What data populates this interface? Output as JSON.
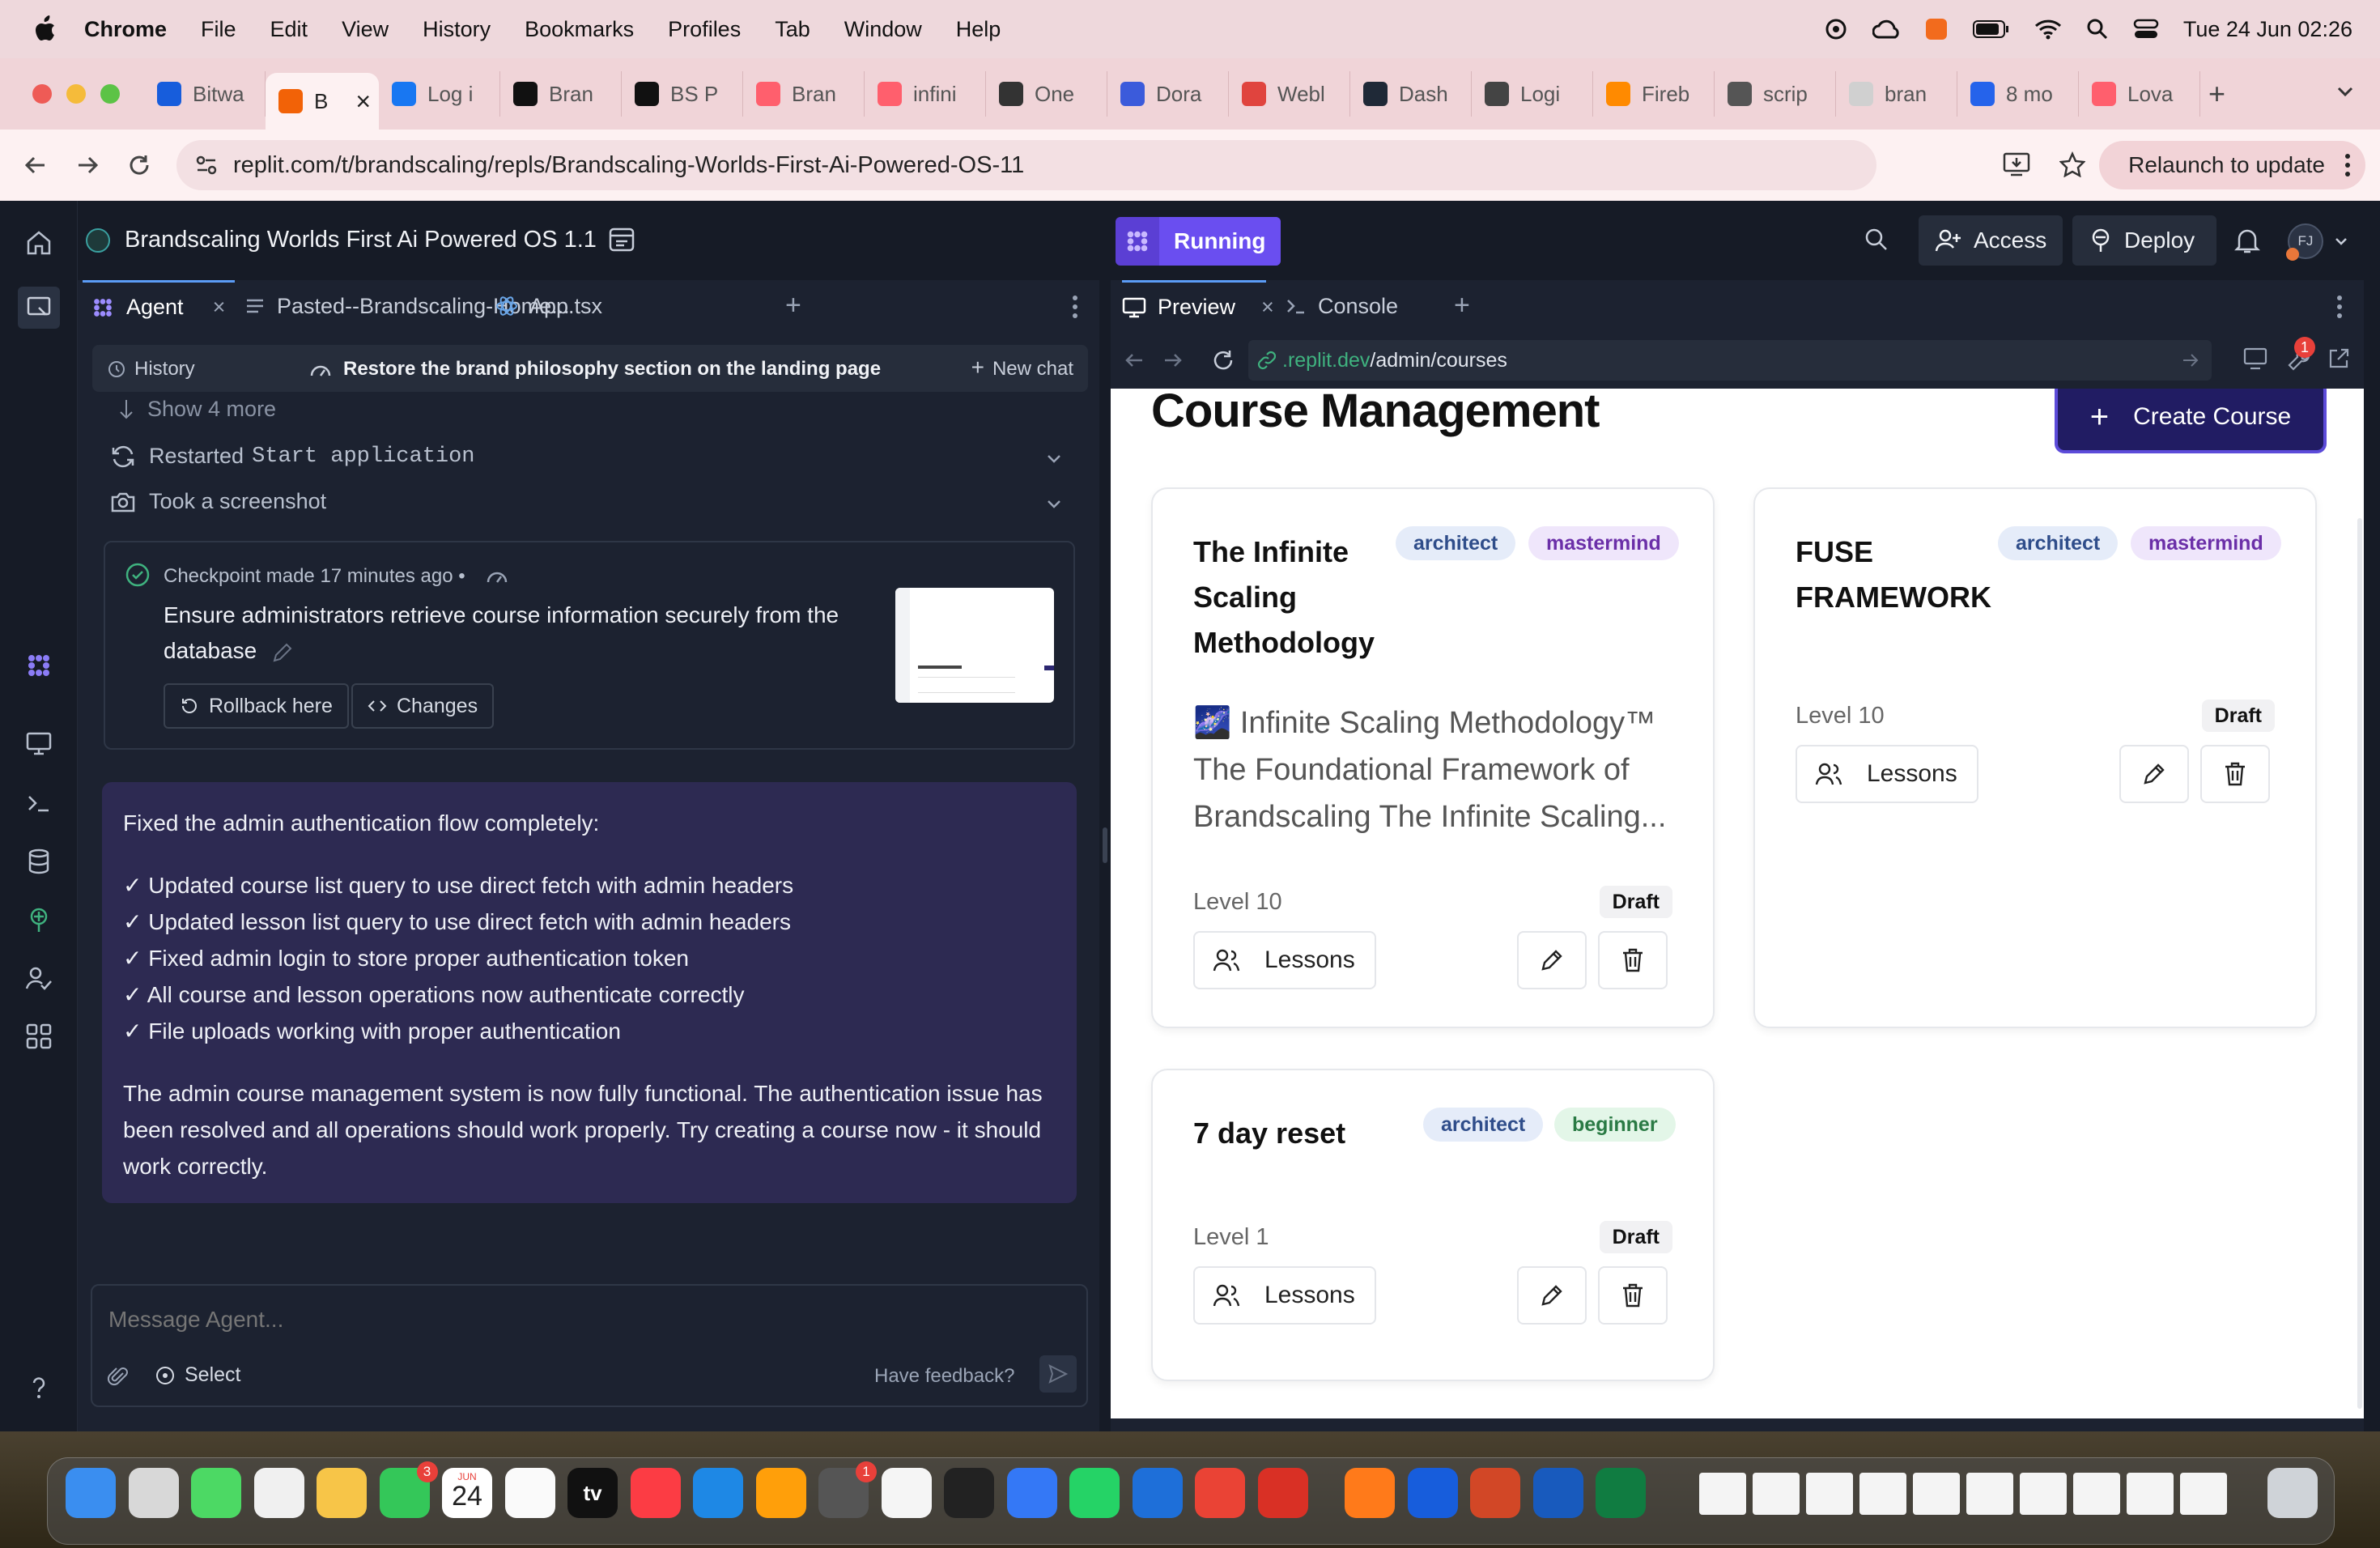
{
  "menubar": {
    "app": "Chrome",
    "items": [
      "File",
      "Edit",
      "View",
      "History",
      "Bookmarks",
      "Profiles",
      "Tab",
      "Window",
      "Help"
    ],
    "datetime": "Tue 24 Jun  02:26"
  },
  "tabs": [
    {
      "label": "Bitwa",
      "color": "#175ddc"
    },
    {
      "label": "B",
      "color": "#f26207",
      "active": true
    },
    {
      "label": "Log i",
      "color": "#1877f2"
    },
    {
      "label": "Bran",
      "color": "#111111"
    },
    {
      "label": "BS P",
      "color": "#111111"
    },
    {
      "label": "Bran",
      "color": "#ff5f6d"
    },
    {
      "label": "infini",
      "color": "#ff5f6d"
    },
    {
      "label": "One",
      "color": "#333333"
    },
    {
      "label": "Dora",
      "color": "#3b5bdb"
    },
    {
      "label": "Webl",
      "color": "#e0443e"
    },
    {
      "label": "Dash",
      "color": "#1f2937"
    },
    {
      "label": "Logi",
      "color": "#444444"
    },
    {
      "label": "Fireb",
      "color": "#ff8a00"
    },
    {
      "label": "scrip",
      "color": "#555555"
    },
    {
      "label": "bran",
      "color": "#d0d0d0"
    },
    {
      "label": "8 mo",
      "color": "#2563eb"
    },
    {
      "label": "Lova",
      "color": "#ff5f6d"
    }
  ],
  "tab_close": "×",
  "new_tab": "+",
  "address": {
    "url": "replit.com/t/brandscaling/repls/Brandscaling-Worlds-First-Ai-Powered-OS-11",
    "relaunch": "Relaunch to update"
  },
  "replit": {
    "project_title": "Brandscaling Worlds First Ai Powered OS 1.1",
    "status": "Running",
    "access": "Access",
    "deploy": "Deploy",
    "avatar_initials": "FJ",
    "left_tabs": [
      "Agent",
      "Pasted--Brandscaling-Home...",
      "App.tsx"
    ],
    "right_tabs": [
      "Preview",
      "Console"
    ],
    "history_label": "History",
    "chat_title": "Restore the brand philosophy section on the landing page",
    "new_chat": "New chat",
    "show_more": "Show 4 more",
    "restarted_prefix": "Restarted",
    "restarted_cmd": "Start application",
    "screenshot": "Took a screenshot",
    "checkpoint_meta": "Checkpoint made 17 minutes ago  •",
    "checkpoint_desc": "Ensure administrators retrieve course information securely from the database",
    "rollback": "Rollback here",
    "changes": "Changes",
    "message": {
      "intro": "Fixed the admin authentication flow completely:",
      "items": [
        "✓ Updated course list query to use direct fetch with admin headers",
        "✓ Updated lesson list query to use direct fetch with admin headers",
        "✓ Fixed admin login to store proper authentication token",
        "✓ All course and lesson operations now authenticate correctly",
        "✓ File uploads working with proper authentication"
      ],
      "outro": "The admin course management system is now fully functional. The authentication issue has been resolved and all operations should work properly. Try creating a course now - it should work correctly."
    },
    "composer": {
      "placeholder": "Message Agent...",
      "select": "Select",
      "feedback": "Have feedback?"
    },
    "preview": {
      "url_host": ".replit.dev",
      "url_path": "/admin/courses",
      "badge_count": "1",
      "page_title": "Course Management",
      "create_button": "Create Course",
      "courses": [
        {
          "title": "The Infinite Scaling Methodology",
          "tags": [
            "architect",
            "mastermind"
          ],
          "description": "🌌 Infinite Scaling Methodology™ The Foundational Framework of Brandscaling The Infinite Scaling...",
          "level": "Level 10",
          "status": "Draft",
          "lessons": "Lessons"
        },
        {
          "title": "FUSE FRAMEWORK",
          "tags": [
            "architect",
            "mastermind"
          ],
          "description": "",
          "level": "Level 10",
          "status": "Draft",
          "lessons": "Lessons"
        },
        {
          "title": "7 day reset",
          "tags": [
            "architect",
            "beginner"
          ],
          "description": "",
          "level": "Level 1",
          "status": "Draft",
          "lessons": "Lessons"
        }
      ]
    }
  },
  "dock": {
    "calendar_month": "JUN",
    "calendar_day": "24",
    "tv_label": "tv",
    "badges": [
      "3",
      "1"
    ]
  }
}
